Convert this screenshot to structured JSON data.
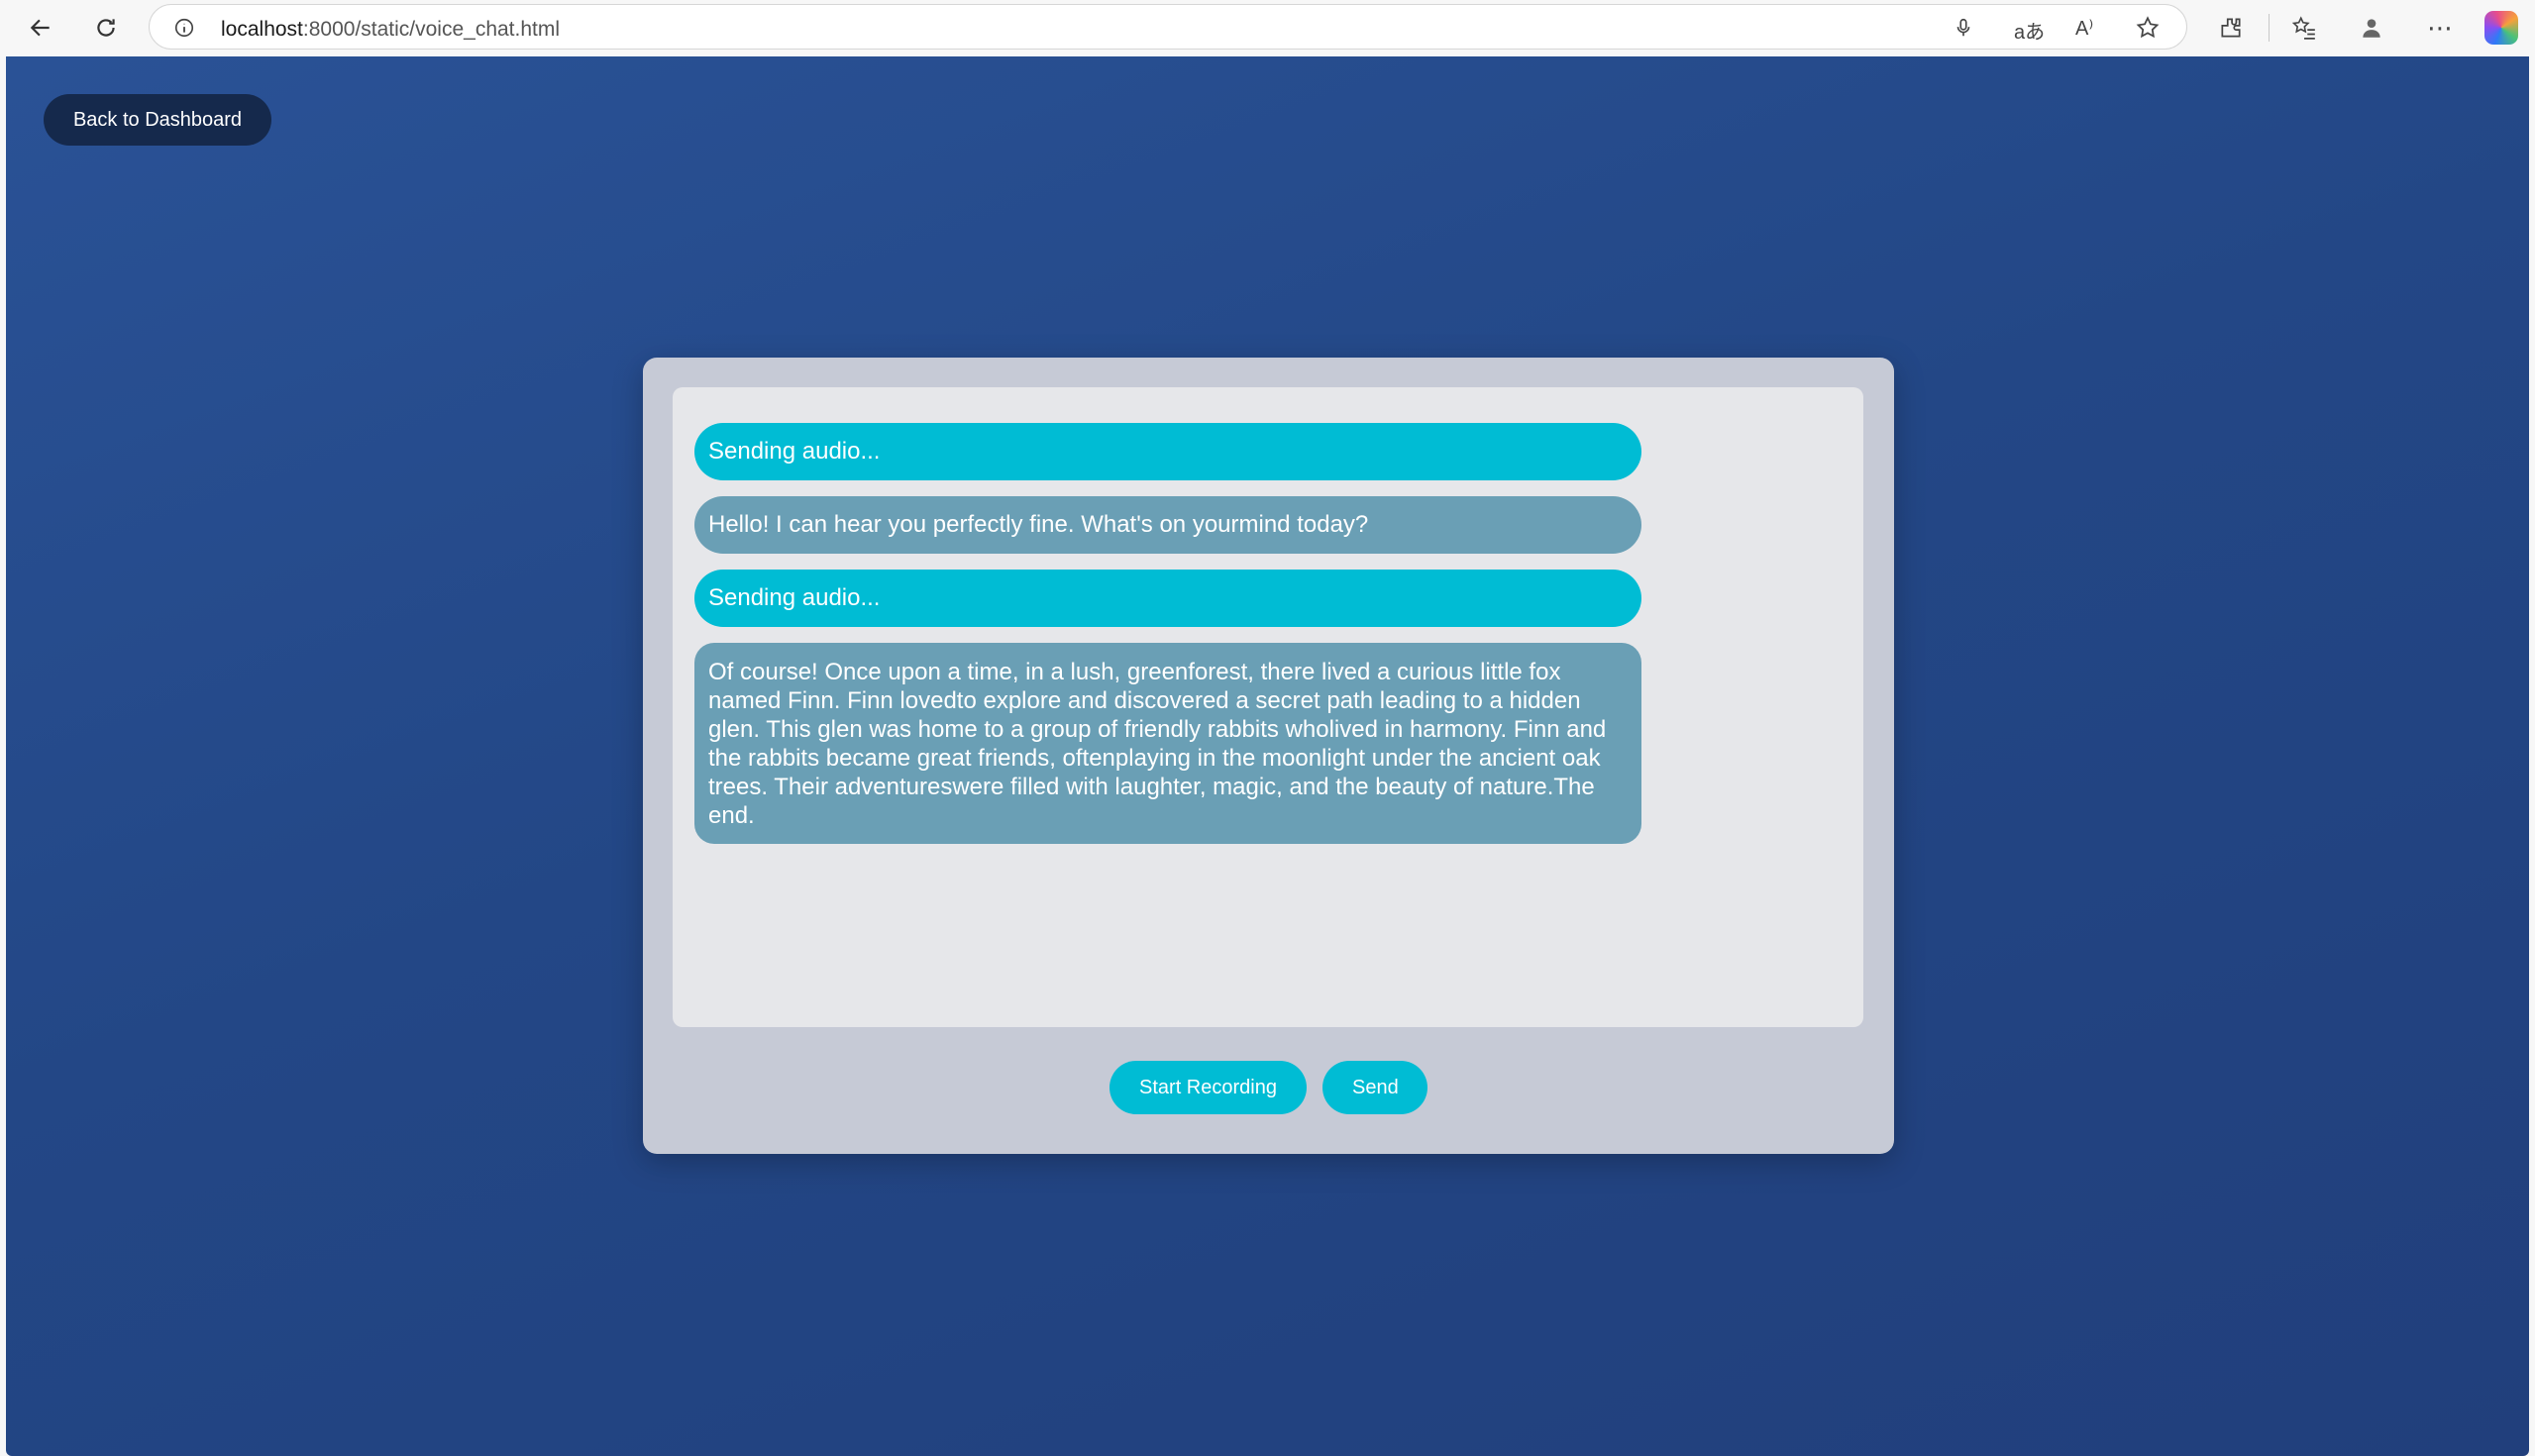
{
  "browser": {
    "url_host": "localhost",
    "url_rest": ":8000/static/voice_chat.html"
  },
  "page": {
    "back_button": "Back to Dashboard"
  },
  "chat": {
    "messages": [
      {
        "role": "user",
        "text": "Sending audio..."
      },
      {
        "role": "assistant",
        "text": "Hello! I can hear you perfectly fine. What's on yourmind today?"
      },
      {
        "role": "user",
        "text": "Sending audio..."
      },
      {
        "role": "assistant",
        "text": "Of course! Once upon a time, in a lush, greenforest, there lived a curious little fox named Finn. Finn lovedto explore and discovered a secret path leading to a hidden glen. This glen was home to a group of friendly rabbits wholived in harmony. Finn and the rabbits became great friends, oftenplaying in the moonlight under the ancient oak trees. Their adventureswere filled with laughter, magic, and the beauty of nature.The end."
      }
    ]
  },
  "controls": {
    "record_label": "Start Recording",
    "send_label": "Send"
  },
  "colors": {
    "user_bubble": "#00bcd4",
    "assistant_bubble": "#6a9fb5",
    "background": "#234786",
    "back_button": "#15294c"
  }
}
